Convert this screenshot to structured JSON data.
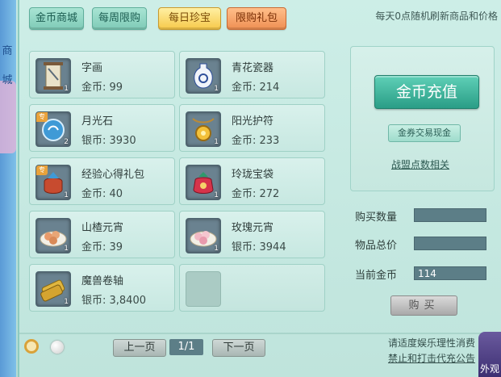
{
  "tabs": [
    {
      "label": "金币商城",
      "style": "green",
      "active": false
    },
    {
      "label": "每周限购",
      "style": "green",
      "active": false
    },
    {
      "label": "每日珍宝",
      "style": "gold",
      "active": true
    },
    {
      "label": "限购礼包",
      "style": "orange",
      "active": false
    }
  ],
  "notice": "每天0点随机刷新商品和价格",
  "left_strip_chars": [
    "商",
    "城"
  ],
  "items": [
    {
      "name": "字画",
      "price": "金币: 99",
      "qty": "1",
      "icon": "scroll-painting-icon",
      "special": false
    },
    {
      "name": "青花瓷器",
      "price": "金币: 214",
      "qty": "1",
      "icon": "porcelain-vase-icon",
      "special": false
    },
    {
      "name": "月光石",
      "price": "银币: 3930",
      "qty": "2",
      "icon": "moonstone-icon",
      "special": true
    },
    {
      "name": "阳光护符",
      "price": "金币: 233",
      "qty": "1",
      "icon": "sun-amulet-icon",
      "special": false
    },
    {
      "name": "经验心得礼包",
      "price": "金币: 40",
      "qty": "1",
      "icon": "exp-gift-bag-icon",
      "special": true
    },
    {
      "name": "玲珑宝袋",
      "price": "金币: 272",
      "qty": "1",
      "icon": "treasure-bag-icon",
      "special": false
    },
    {
      "name": "山楂元宵",
      "price": "金币: 39",
      "qty": "1",
      "icon": "hawthorn-dumpling-icon",
      "special": false
    },
    {
      "name": "玫瑰元宵",
      "price": "银币: 3944",
      "qty": "1",
      "icon": "rose-dumpling-icon",
      "special": false
    },
    {
      "name": "魔兽卷轴",
      "price": "银币: 3,8400",
      "qty": "1",
      "icon": "beast-scroll-icon",
      "special": false
    }
  ],
  "special_badge": "专",
  "right": {
    "recharge": "金币充值",
    "ticket_trade": "金券交易现金",
    "points_link": "战盟点数相关"
  },
  "form": {
    "qty_label": "购买数量",
    "total_label": "物品总价",
    "gold_label": "当前金币",
    "current_gold": "114",
    "buy": "购买"
  },
  "pager": {
    "prev": "上一页",
    "page": "1/1",
    "next": "下一页"
  },
  "footer": {
    "line1": "请适度娱乐理性消费",
    "line2": "禁止和打击代充公告"
  },
  "ext_btn": "外观"
}
